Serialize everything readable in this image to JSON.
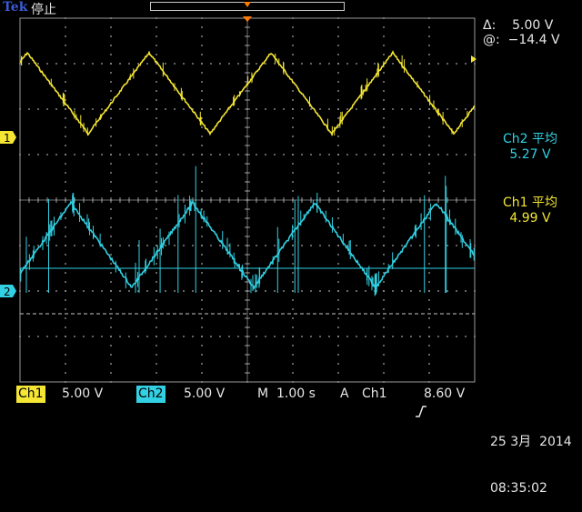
{
  "header": {
    "brand": "Tek",
    "run_status": "停止"
  },
  "cursor": {
    "delta": "Δ:    5.00 V",
    "at": "@:  −14.4 V"
  },
  "measurements": [
    {
      "label": "Ch2 平均",
      "value": "5.27 V",
      "color": "#31d1e3"
    },
    {
      "label": "Ch1 平均",
      "value": "4.99 V",
      "color": "#f4e633"
    }
  ],
  "channel_markers": {
    "ch1": "1",
    "ch2": "2"
  },
  "bottom_bar": {
    "ch1_label": "Ch1",
    "ch1_scale": "5.00 V",
    "ch2_label": "Ch2",
    "ch2_scale": "5.00 V",
    "timebase_label": "M",
    "timebase": "1.00 s",
    "trigger_label": "A",
    "trigger_source": "Ch1",
    "trigger_slope_icon": "rising-edge-icon",
    "trigger_level": "8.60 V"
  },
  "datetime": {
    "date": "25 3月  2014",
    "time": "08:35:02"
  },
  "colors": {
    "ch1": "#f4e633",
    "ch2": "#31d1e3",
    "trigger": "#ff7a00",
    "grid": "#9a9a9a"
  }
}
